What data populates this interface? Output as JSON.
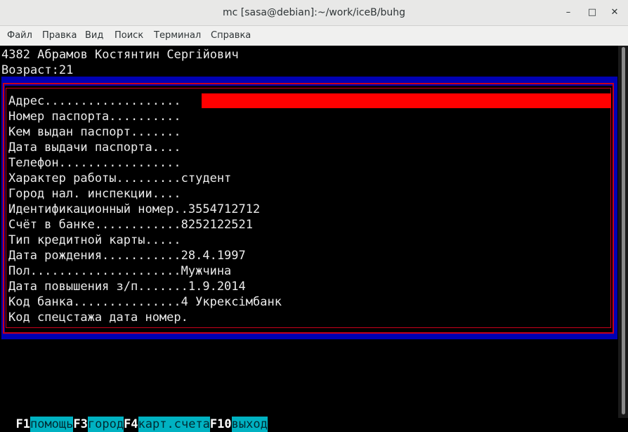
{
  "window": {
    "title": "mc [sasa@debian]:~/work/iceB/buhg",
    "minimize": "–",
    "maximize": "□",
    "close": "✕"
  },
  "menu": [
    "Файл",
    "Правка",
    "Вид",
    "Поиск",
    "Терминал",
    "Справка"
  ],
  "header": {
    "person": "4382 Абрамов Костянтин Сергійович",
    "age": "Возраст:21"
  },
  "form": {
    "rows": [
      {
        "label": "Адрес...................",
        "value": ""
      },
      {
        "label": "Номер паспорта..........",
        "value": ""
      },
      {
        "label": "Кем выдан паспорт.......",
        "value": ""
      },
      {
        "label": "Дата выдачи паспорта....",
        "value": ""
      },
      {
        "label": "Телефон.................",
        "value": ""
      },
      {
        "label": "Характер работы.........",
        "value": "студент"
      },
      {
        "label": "Город нал. инспекции....",
        "value": ""
      },
      {
        "label": "Идентификационный номер..",
        "value": "3554712712"
      },
      {
        "label": "Счёт в банке............",
        "value": "8252122521"
      },
      {
        "label": "Тип кредитной карты.....",
        "value": ""
      },
      {
        "label": "Дата рождения...........",
        "value": "28.4.1997"
      },
      {
        "label": "Пол.....................",
        "value": "Мужчина"
      },
      {
        "label": "Дата повышения з/п.......",
        "value": "1.9.2014"
      },
      {
        "label": "Код банка...............",
        "value": "4 Укрексімбанк"
      },
      {
        "label": "Код спецстажа дата номер.",
        "value": ""
      }
    ]
  },
  "fkeys": [
    {
      "key": "F1",
      "label": "помощь"
    },
    {
      "key": "F3",
      "label": "город"
    },
    {
      "key": "F4",
      "label": "карт.счета"
    },
    {
      "key": "F10",
      "label": "выход"
    }
  ],
  "colors": {
    "dialog": "#0000b4",
    "frame": "#c8001a",
    "active_field": "#ff0000",
    "fkey_label": "#00b2c2"
  }
}
